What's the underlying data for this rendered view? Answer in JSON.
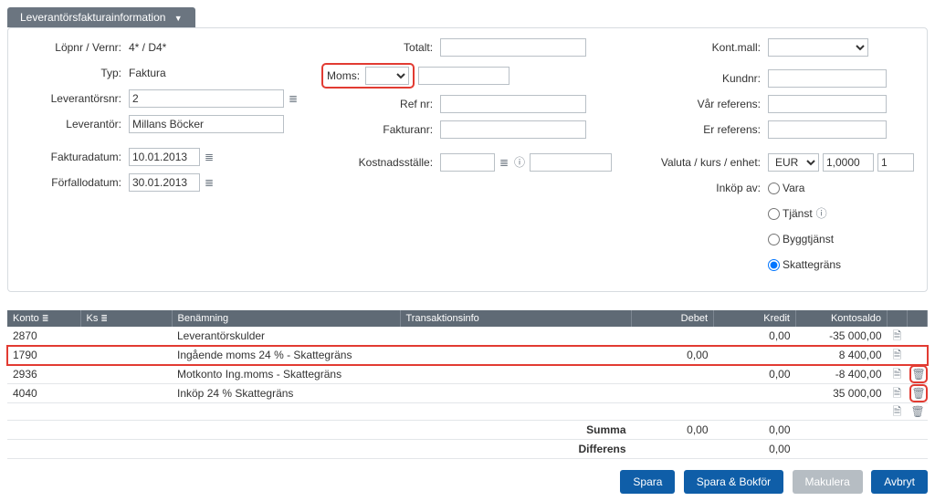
{
  "header": {
    "tab": "Leverantörsfakturainformation"
  },
  "left": {
    "lopnr_label": "Löpnr / Vernr:",
    "lopnr_value": "4* / D4*",
    "typ_label": "Typ:",
    "typ_value": "Faktura",
    "levnr_label": "Leverantörsnr:",
    "levnr_value": "2",
    "lev_label": "Leverantör:",
    "lev_value": "Millans Böcker",
    "faktdatum_label": "Fakturadatum:",
    "faktdatum_value": "10.01.2013",
    "forfallo_label": "Förfallodatum:",
    "forfallo_value": "30.01.2013"
  },
  "mid": {
    "totalt_label": "Totalt:",
    "moms_label": "Moms:",
    "refnr_label": "Ref nr:",
    "fakturanr_label": "Fakturanr:",
    "kostnad_label": "Kostnadsställe:"
  },
  "right": {
    "kontmall_label": "Kont.mall:",
    "kundnr_label": "Kundnr:",
    "varref_label": "Vår referens:",
    "erref_label": "Er referens:",
    "valuta_label": "Valuta / kurs / enhet:",
    "valuta_value": "EUR",
    "kurs_value": "1,0000",
    "enhet_value": "1",
    "inkop_label": "Inköp av:",
    "opt_vara": "Vara",
    "opt_tjanst": "Tjänst",
    "opt_bygg": "Byggtjänst",
    "opt_skatt": "Skattegräns"
  },
  "grid": {
    "headers": {
      "konto": "Konto",
      "ks": "Ks",
      "benamning": "Benämning",
      "trans": "Transaktionsinfo",
      "debet": "Debet",
      "kredit": "Kredit",
      "saldo": "Kontosaldo"
    },
    "rows": [
      {
        "konto": "2870",
        "ks": "",
        "benamning": "Leverantörskulder",
        "trans": "",
        "debet": "",
        "kredit": "0,00",
        "saldo": "-35 000,00",
        "doc": true,
        "trash": false,
        "highlight": false
      },
      {
        "konto": "1790",
        "ks": "",
        "benamning": "Ingående moms 24 % - Skattegräns",
        "trans": "",
        "debet": "0,00",
        "kredit": "",
        "saldo": "8 400,00",
        "doc": true,
        "trash": false,
        "highlight": true
      },
      {
        "konto": "2936",
        "ks": "",
        "benamning": "Motkonto Ing.moms - Skattegräns",
        "trans": "",
        "debet": "",
        "kredit": "0,00",
        "saldo": "-8 400,00",
        "doc": true,
        "trash": true,
        "highlight": false,
        "trash_hl": true
      },
      {
        "konto": "4040",
        "ks": "",
        "benamning": "Inköp 24 %  Skattegräns",
        "trans": "",
        "debet": "",
        "kredit": "",
        "saldo": "35 000,00",
        "doc": true,
        "trash": true,
        "highlight": false,
        "trash_hl": true
      },
      {
        "konto": "",
        "ks": "",
        "benamning": "",
        "trans": "",
        "debet": "",
        "kredit": "",
        "saldo": "",
        "doc": true,
        "trash": true,
        "highlight": false
      }
    ],
    "summa_label": "Summa",
    "summa_debet": "0,00",
    "summa_kredit": "0,00",
    "diff_label": "Differens",
    "diff_kredit": "0,00"
  },
  "buttons": {
    "spara": "Spara",
    "spara_bokfor": "Spara & Bokför",
    "makulera": "Makulera",
    "avbryt": "Avbryt"
  }
}
